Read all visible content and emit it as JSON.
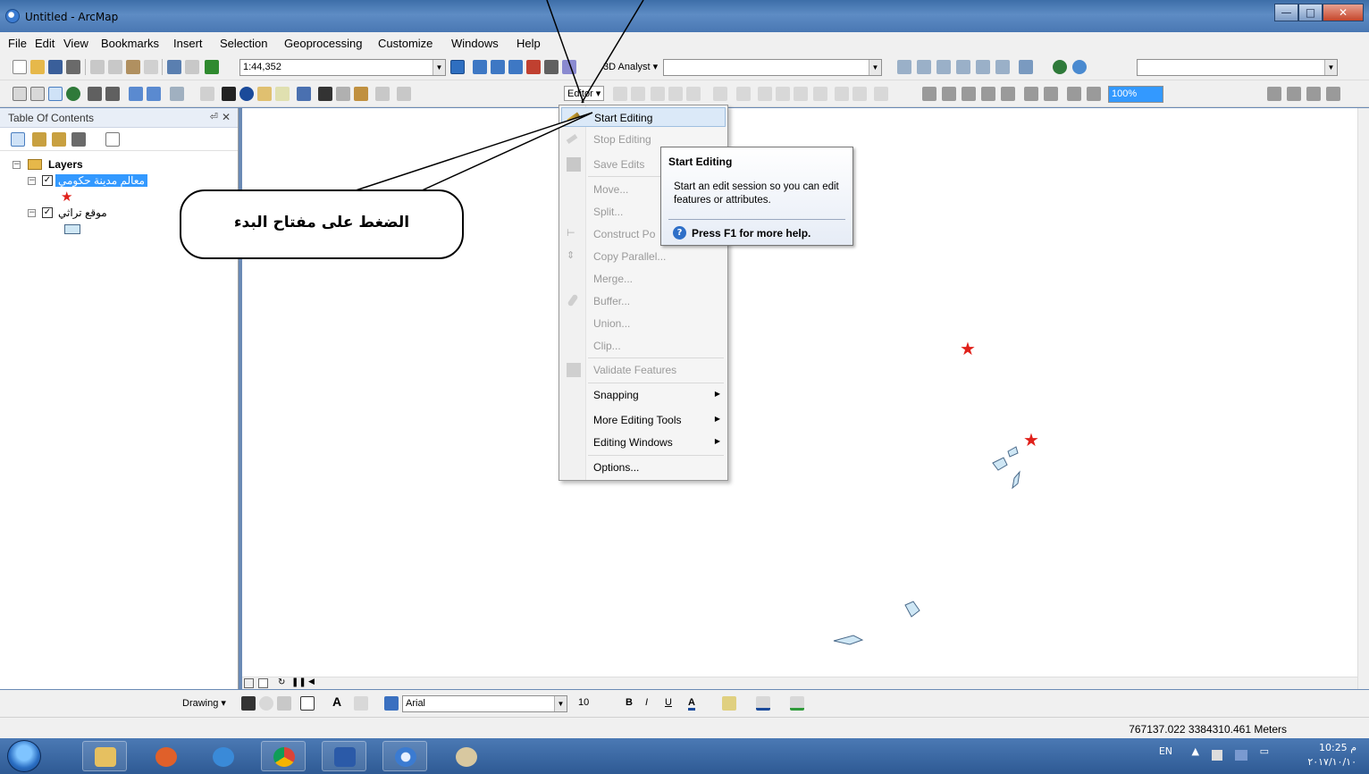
{
  "window": {
    "title": "Untitled - ArcMap"
  },
  "menu": [
    "File",
    "Edit",
    "View",
    "Bookmarks",
    "Insert",
    "Selection",
    "Geoprocessing",
    "Customize",
    "Windows",
    "Help"
  ],
  "toolbar": {
    "scale": "1:44,352",
    "analyst_label": "3D Analyst ▾",
    "editor_label": "Editor ▾",
    "zoom_value": "100%"
  },
  "toc": {
    "title": "Table Of Contents",
    "pin": "1",
    "close": "✕",
    "root": "Layers",
    "layers": [
      {
        "name": "معالم مدينة حكومي",
        "checked": true,
        "selected": true,
        "symbol": "red-star"
      },
      {
        "name": "موقع تراثي",
        "checked": true,
        "selected": false,
        "symbol": "light-blue-polygon"
      }
    ]
  },
  "editor_menu": {
    "items": [
      {
        "label": "Start Editing",
        "state": "active"
      },
      {
        "label": "Stop Editing",
        "state": "disabled"
      },
      {
        "label": "Save Edits",
        "state": "disabled"
      },
      {
        "label": "Move...",
        "state": "disabled"
      },
      {
        "label": "Split...",
        "state": "disabled"
      },
      {
        "label": "Construct Po",
        "state": "disabled"
      },
      {
        "label": "Copy Parallel...",
        "state": "disabled"
      },
      {
        "label": "Merge...",
        "state": "disabled"
      },
      {
        "label": "Buffer...",
        "state": "disabled"
      },
      {
        "label": "Union...",
        "state": "disabled"
      },
      {
        "label": "Clip...",
        "state": "disabled"
      },
      {
        "label": "Validate Features",
        "state": "disabled"
      },
      {
        "label": "Snapping",
        "state": "enabled",
        "submenu": true
      },
      {
        "label": "More Editing Tools",
        "state": "enabled",
        "submenu": true
      },
      {
        "label": "Editing Windows",
        "state": "enabled",
        "submenu": true
      },
      {
        "label": "Options...",
        "state": "enabled"
      }
    ]
  },
  "tooltip": {
    "title": "Start Editing",
    "body": "Start an edit session so you can edit features or attributes.",
    "help": "Press F1 for more help."
  },
  "callout": {
    "text": "الضغط على مفتاح البدء"
  },
  "drawing": {
    "label": "Drawing ▾",
    "font": "Arial",
    "size": "10",
    "bold": "B",
    "italic": "I",
    "underline": "U"
  },
  "status": {
    "coordinates": "767137.022  3384310.461 Meters"
  },
  "taskbar": {
    "lang": "EN",
    "time": "10:25 م",
    "date": "٢٠١٧/١٠/١٠"
  },
  "colors": {
    "accent": "#3399ff",
    "star": "#e0201a",
    "polygon_fill": "#cfe7f5"
  }
}
